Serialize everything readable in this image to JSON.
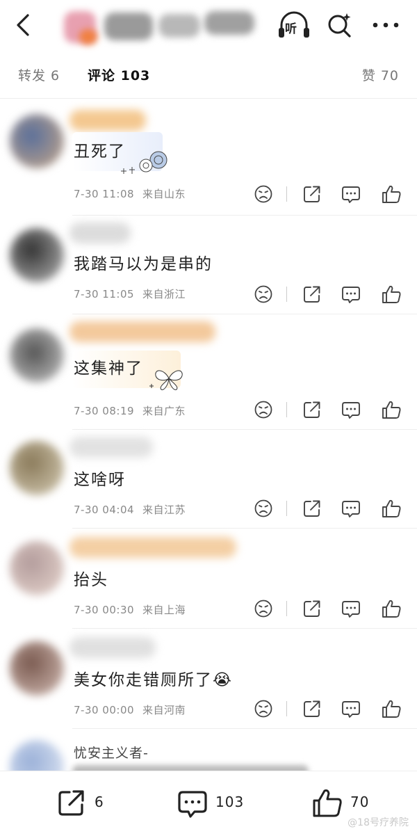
{
  "tabs": {
    "repost": "转发 6",
    "comment": "评论 103",
    "like": "赞 70"
  },
  "header": {
    "listen_label": "听",
    "icons": [
      "back-arrow-icon",
      "headphones-icon",
      "search-icon",
      "more-icon"
    ]
  },
  "comments": [
    {
      "text": "丑死了",
      "date": "7-30 11:08",
      "location": "来自山东"
    },
    {
      "text": "我踏马以为是串的",
      "date": "7-30 11:05",
      "location": "来自浙江"
    },
    {
      "text": "这集神了",
      "date": "7-30 08:19",
      "location": "来自广东"
    },
    {
      "text": "这啥呀",
      "date": "7-30 04:04",
      "location": "来自江苏"
    },
    {
      "text": "抬头",
      "date": "7-30 00:30",
      "location": "来自上海"
    },
    {
      "text": "美女你走错厕所了😭",
      "date": "7-30 00:00",
      "location": "来自河南"
    }
  ],
  "partial_comment": {
    "author": "忧安主义者-"
  },
  "bottom_bar": {
    "repost_count": "6",
    "comment_count": "103",
    "like_count": "70"
  },
  "watermark": "@18号疗养院",
  "colors": {
    "text": "#222222",
    "meta": "#888888",
    "divider": "#eeeeee"
  }
}
